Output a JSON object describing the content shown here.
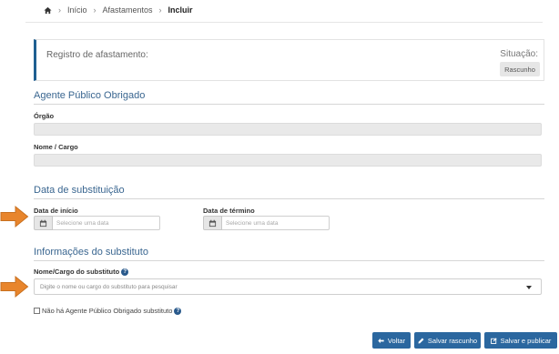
{
  "breadcrumb": {
    "home_icon": "home-icon",
    "items": [
      "Início",
      "Afastamentos",
      "Incluir"
    ]
  },
  "record": {
    "title": "Registro de afastamento:",
    "situacao_label": "Situação:",
    "situacao_value": "Rascunho"
  },
  "agente": {
    "section_title": "Agente Público Obrigado",
    "orgao_label": "Órgão",
    "nome_cargo_label": "Nome / Cargo"
  },
  "substituicao": {
    "section_title": "Data de substituição",
    "inicio_label": "Data de início",
    "inicio_placeholder": "Selecione uma data",
    "termino_label": "Data de término",
    "termino_placeholder": "Selecione uma data"
  },
  "substituto": {
    "section_title": "Informações do substituto",
    "nome_cargo_label": "Nome/Cargo do substituto",
    "search_placeholder": "Digite o nome ou cargo do substituto para pesquisar",
    "checkbox_label": "Não há Agente Público Obrigado substituto"
  },
  "actions": {
    "voltar": "Voltar",
    "salvar_rascunho": "Salvar rascunho",
    "salvar_publicar": "Salvar e publicar"
  },
  "colors": {
    "primary": "#2b679f",
    "accent_border": "#1f5f91",
    "section_title": "#3a6690",
    "annotation_arrow": "#e8852c"
  }
}
